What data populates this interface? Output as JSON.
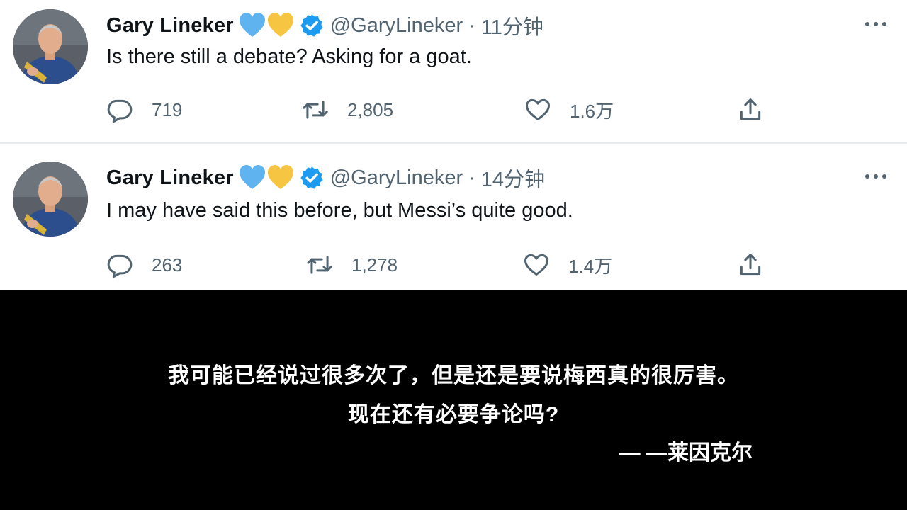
{
  "tweets": [
    {
      "author_name": "Gary Lineker",
      "emojis": [
        "blue-heart",
        "yellow-heart"
      ],
      "handle": "@GaryLineker",
      "separator": "·",
      "time": "11分钟",
      "text": "Is there still a debate? Asking for a goat.",
      "replies": "719",
      "retweets": "2,805",
      "likes": "1.6万"
    },
    {
      "author_name": "Gary Lineker",
      "emojis": [
        "blue-heart",
        "yellow-heart"
      ],
      "handle": "@GaryLineker",
      "separator": "·",
      "time": "14分钟",
      "text": "I may have said this before, but Messi’s quite good.",
      "replies": "263",
      "retweets": "1,278",
      "likes": "1.4万"
    }
  ],
  "subtitles": {
    "line1": "我可能已经说过很多次了，但是还是要说梅西真的很厉害。",
    "line2": "现在还有必要争论吗?",
    "attribution": "— —莱因克尔"
  },
  "colors": {
    "verified_badge": "#1d9bf0",
    "blue_heart": "#5fb4f0",
    "yellow_heart": "#f6c542",
    "secondary_text": "#536471",
    "subtitle_background": "#000000"
  },
  "icons": [
    "reply-icon",
    "retweet-icon",
    "like-icon",
    "share-icon",
    "more-icon",
    "verified-badge-icon"
  ]
}
